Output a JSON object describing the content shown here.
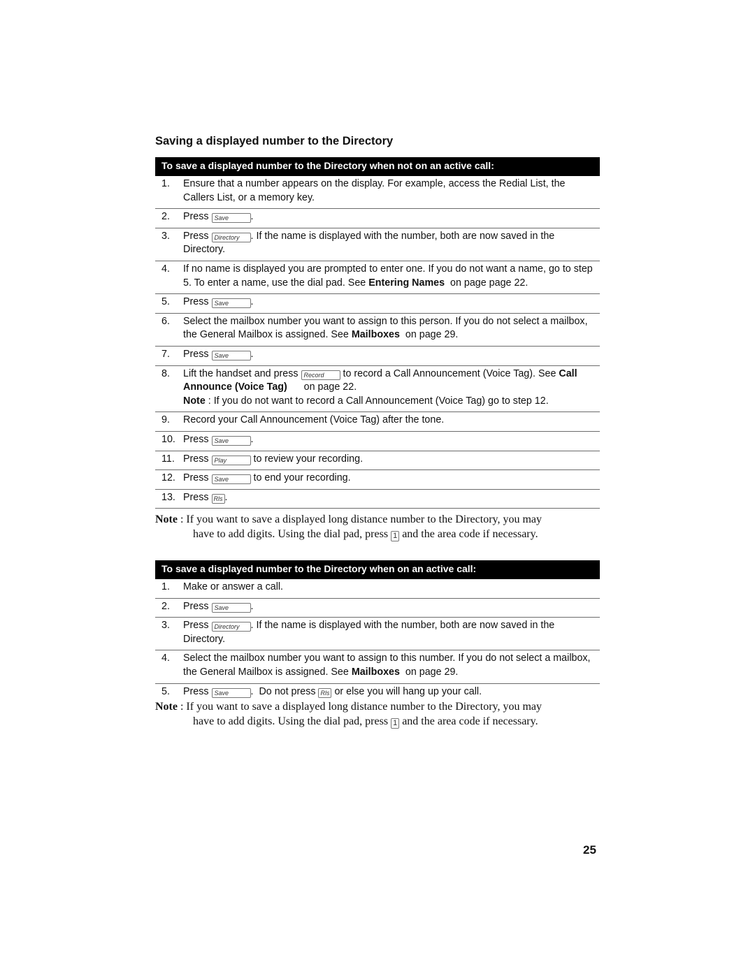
{
  "section_title": "Saving a displayed number to the Directory",
  "procedure1": {
    "banner": "To save a displayed number to the Directory when not on an active call:",
    "steps": [
      {
        "num": "1.",
        "text": "Ensure that a number appears on the display. For example, access the Redial List, the Callers List, or a memory key."
      },
      {
        "num": "2.",
        "pre": "Press ",
        "key": "Save",
        "post": "."
      },
      {
        "num": "3.",
        "pre": "Press ",
        "key": "Directory",
        "post": ". If the name is displayed with the number, both are now saved in the Directory."
      },
      {
        "num": "4.",
        "pre": "If no name is displayed you are prompted to enter one. If you do not want a name, go to step 5. To enter a name, use the dial pad. See ",
        "link": "Entering Names",
        "post": "  on page page 22."
      },
      {
        "num": "5.",
        "pre": "Press ",
        "key": "Save",
        "post": "."
      },
      {
        "num": "6.",
        "pre": "Select the mailbox number you want to assign to this person. If you do not select a mailbox, the General Mailbox is assigned. See ",
        "link": "Mailboxes",
        "post": "  on page 29."
      },
      {
        "num": "7.",
        "pre": "Press ",
        "key": "Save",
        "post": "."
      },
      {
        "num": "8.",
        "pre": "Lift the handset and press ",
        "key": "Record",
        "mid": " to record a Call Announcement (Voice Tag). See ",
        "link": "Call Announce (Voice Tag)",
        "post": "      on page 22.",
        "note_label": "Note",
        "note_text": " : If you do not want to record a Call Announcement (Voice Tag) go to step 12."
      },
      {
        "num": "9.",
        "text": "Record your Call Announcement (Voice Tag) after the tone."
      },
      {
        "num": "10.",
        "pre": "Press ",
        "key": "Save",
        "post": "."
      },
      {
        "num": "11.",
        "pre": "Press ",
        "key": "Play",
        "post": " to review your recording."
      },
      {
        "num": "12.",
        "pre": "Press ",
        "key": "Save",
        "post": " to end your recording."
      },
      {
        "num": "13.",
        "pre": "Press ",
        "key": "Rls",
        "post": "."
      }
    ],
    "note": {
      "label": "Note",
      "line1": " : If you want to save a displayed long distance number to the Directory, you may",
      "line2_pre": "have to add digits. Using the dial pad, press ",
      "key": "1",
      "line2_post": " and the area code if necessary."
    }
  },
  "procedure2": {
    "banner": "To save a displayed number to the Directory when on an active call:",
    "steps": [
      {
        "num": "1.",
        "text": "Make or answer a call."
      },
      {
        "num": "2.",
        "pre": "Press ",
        "key": "Save",
        "post": "."
      },
      {
        "num": "3.",
        "pre": "Press ",
        "key": "Directory",
        "post": ". If the name is displayed with the number, both are now saved in the Directory."
      },
      {
        "num": "4.",
        "pre": "Select the mailbox number you want to assign to this number. If you do not select a mailbox, the General Mailbox is assigned. See ",
        "link": "Mailboxes",
        "post": "  on page 29."
      },
      {
        "num": "5.",
        "pre": "Press ",
        "key": "Save",
        "mid": ".  Do not press ",
        "key2": "Rls",
        "post": " or else you will hang up your call."
      }
    ],
    "note": {
      "label": "Note",
      "line1": " : If you want to save a displayed long distance number to the Directory, you may",
      "line2_pre": "have to add digits. Using the dial pad, press ",
      "key": "1",
      "line2_post": " and the area code if necessary."
    }
  },
  "page_number": "25"
}
